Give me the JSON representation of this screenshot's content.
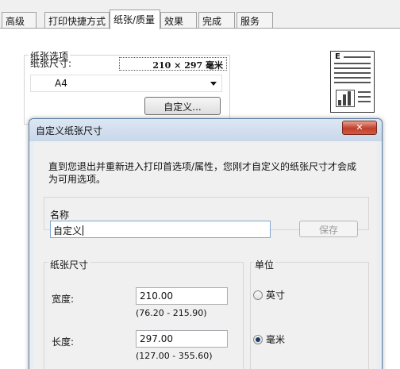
{
  "background_dialog": {
    "tabs": [
      "高级",
      "打印快捷方式",
      "纸张/质量",
      "效果",
      "完成",
      "服务"
    ],
    "active_tab": "纸张/质量",
    "paper_group_title": "纸张选项",
    "paper_size_label": "纸张尺寸:",
    "paper_size_value": "210 × 297 毫米",
    "paper_selected": "A4",
    "custom_button": "自定义...",
    "preview_letter": "E"
  },
  "custom_dialog": {
    "title": "自定义纸张尺寸",
    "close_glyph": "✕",
    "message": "直到您退出并重新进入打印首选项/属性，您刚才自定义的纸张尺寸才会成为可用选项。",
    "name_label": "名称",
    "name_value": "自定义",
    "save_button": "保存",
    "size_group": "纸张尺寸",
    "width_label": "宽度:",
    "width_value": "210.00",
    "width_range": "(76.20 - 215.90)",
    "length_label": "长度:",
    "length_value": "297.00",
    "length_range": "(127.00 - 355.60)",
    "unit_group": "单位",
    "unit_inch": "英寸",
    "unit_mm": "毫米",
    "selected_unit": "毫米"
  },
  "colors": {
    "dialog_border": "#5c7da3",
    "close_button": "#c0402a",
    "titlebar": "#dce7f3"
  }
}
